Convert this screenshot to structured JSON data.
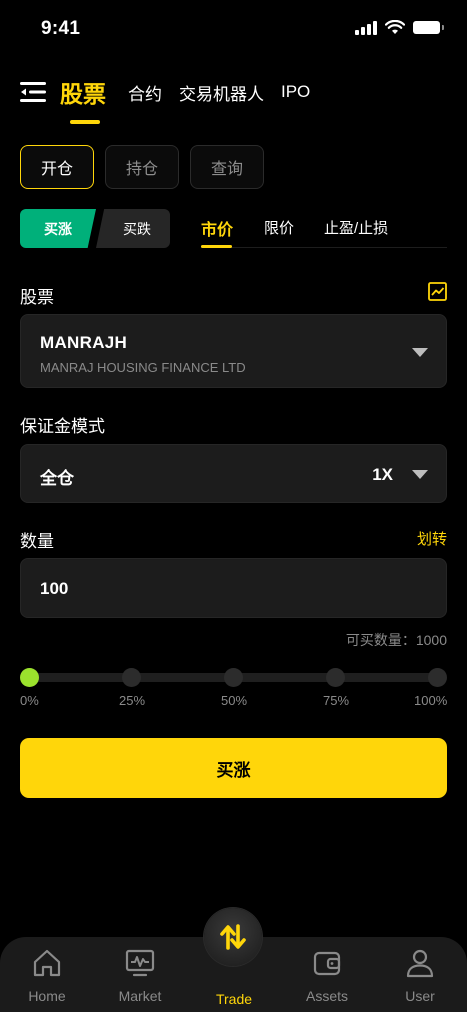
{
  "status_bar": {
    "time": "9:41"
  },
  "top_nav": {
    "active": "股票",
    "items": [
      "合约",
      "交易机器人",
      "IPO"
    ]
  },
  "segments": [
    "开仓",
    "持仓",
    "查询"
  ],
  "trade_side": {
    "buy": "买涨",
    "sell": "买跌"
  },
  "order_types": [
    "市价",
    "限价",
    "止盈/止损"
  ],
  "stock": {
    "label": "股票",
    "symbol": "MANRAJH",
    "name": "MANRAJ HOUSING FINANCE LTD"
  },
  "margin_mode": {
    "label": "保证金模式",
    "value": "全仓",
    "leverage": "1X"
  },
  "quantity": {
    "label": "数量",
    "transfer_link": "划转",
    "value": "100",
    "available": "可买数量：1000"
  },
  "slider": {
    "value_percent": 0,
    "ticks": [
      "0%",
      "25%",
      "50%",
      "75%",
      "100%"
    ]
  },
  "submit_label": "买涨",
  "tab_bar": {
    "tabs": [
      "Home",
      "Market",
      "Trade",
      "Assets",
      "User"
    ],
    "active": "Trade"
  },
  "colors": {
    "accent": "#FFD60A",
    "buy": "#00B07A",
    "slider_active": "#9BE22D",
    "background": "#000000"
  }
}
